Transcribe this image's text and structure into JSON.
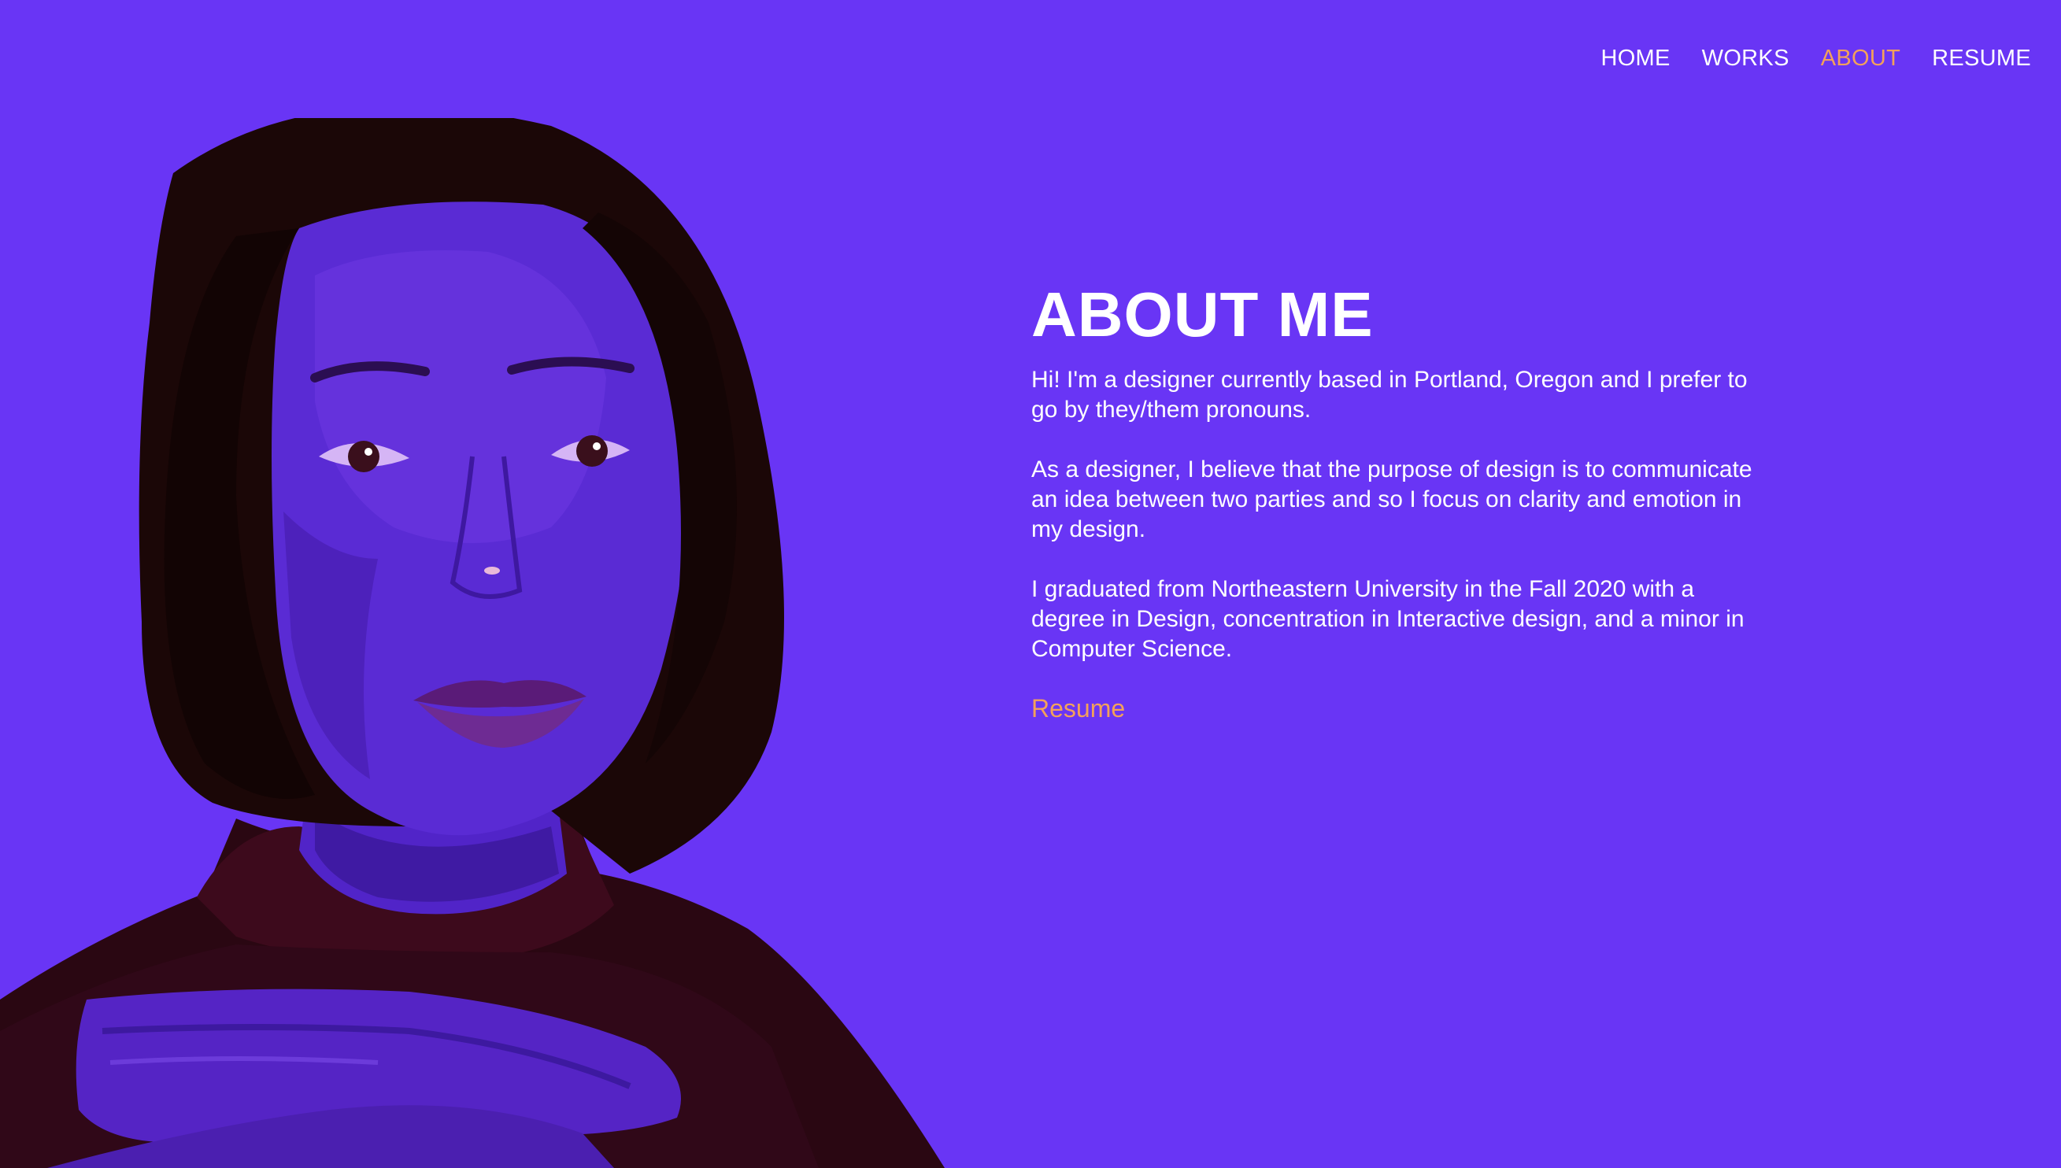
{
  "nav": {
    "items": [
      {
        "label": "HOME",
        "active": false
      },
      {
        "label": "WORKS",
        "active": false
      },
      {
        "label": "ABOUT",
        "active": true
      },
      {
        "label": "RESUME",
        "active": false
      }
    ]
  },
  "about": {
    "title": "ABOUT ME",
    "paragraphs": [
      "Hi! I'm a designer currently based in Portland, Oregon and I prefer to go by they/them pronouns.",
      "As a designer, I believe that the purpose of design is to communicate an idea between two parties and so I focus on clarity and emotion in my design.",
      "I graduated from Northeastern University in the Fall 2020 with a degree in Design, concentration in Interactive design, and a minor in Computer Science."
    ],
    "resume_link": "Resume"
  },
  "colors": {
    "background": "#6935f5",
    "accent": "#f3a15a",
    "text": "#ffffff"
  }
}
